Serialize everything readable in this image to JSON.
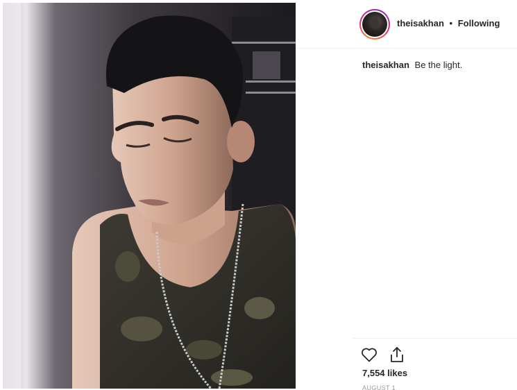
{
  "post": {
    "username": "theisakhan",
    "separator": "•",
    "follow_status": "Following",
    "caption_text": "Be the light.",
    "likes": "7,554 likes",
    "date": "AUGUST 1"
  },
  "icons": {
    "like": "heart-icon",
    "share": "share-icon"
  },
  "colors": {
    "text": "#262626",
    "muted": "#999999",
    "divider": "#efefef",
    "avatar_ring": [
      "#f58529",
      "#dd2a7b",
      "#8134af"
    ]
  }
}
